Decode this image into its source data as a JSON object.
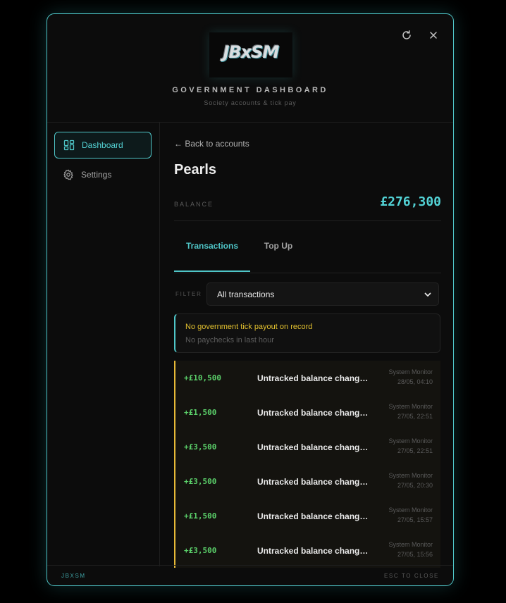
{
  "header": {
    "logo_text": "JBxSM",
    "title": "GOVERNMENT DASHBOARD",
    "subtitle": "Society accounts & tick pay",
    "refresh_icon": "refresh-icon",
    "close_icon": "close-icon"
  },
  "sidebar": {
    "items": [
      {
        "label": "Dashboard",
        "icon": "dashboard-grid-icon",
        "active": true
      },
      {
        "label": "Settings",
        "icon": "gear-icon",
        "active": false
      }
    ]
  },
  "main": {
    "back_label": "← Back to accounts",
    "account_name": "Pearls",
    "balance_label": "BALANCE",
    "balance_value": "£276,300",
    "tabs": [
      {
        "label": "Transactions",
        "active": true
      },
      {
        "label": "Top Up",
        "active": false
      }
    ],
    "filter_label": "FILTER",
    "filter_value": "All transactions",
    "notice": {
      "title": "No government tick payout on record",
      "subtitle": "No paychecks in last hour"
    },
    "transactions": [
      {
        "amount": "+£10,500",
        "description": "Untracked balance change detected",
        "source": "System Monitor",
        "time": "28/05, 04:10"
      },
      {
        "amount": "+£1,500",
        "description": "Untracked balance change detected",
        "source": "System Monitor",
        "time": "27/05, 22:51"
      },
      {
        "amount": "+£3,500",
        "description": "Untracked balance change detected",
        "source": "System Monitor",
        "time": "27/05, 22:51"
      },
      {
        "amount": "+£3,500",
        "description": "Untracked balance change detected",
        "source": "System Monitor",
        "time": "27/05, 20:30"
      },
      {
        "amount": "+£1,500",
        "description": "Untracked balance change detected",
        "source": "System Monitor",
        "time": "27/05, 15:57"
      },
      {
        "amount": "+£3,500",
        "description": "Untracked balance change detected",
        "source": "System Monitor",
        "time": "27/05, 15:56"
      }
    ]
  },
  "footer": {
    "brand": "JBXSM",
    "hint": "ESC TO CLOSE"
  },
  "colors": {
    "accent": "#4fc6c8",
    "positive": "#5bd06a",
    "warning": "#e2c02f",
    "row_marker": "#e7b937"
  }
}
